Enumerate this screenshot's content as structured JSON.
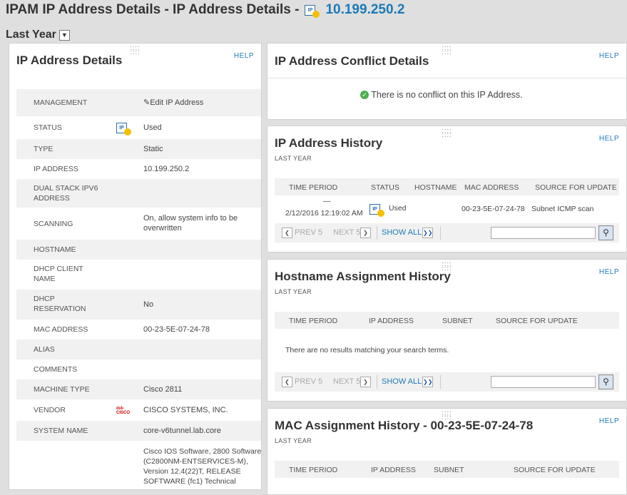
{
  "page": {
    "title": "IPAM IP Address Details - IP Address Details -",
    "ip_link": "10.199.250.2",
    "ip_icon_text": "IP",
    "period": "Last Year"
  },
  "common": {
    "help": "HELP",
    "last_year": "LAST YEAR",
    "prev": "PREV 5",
    "next": "NEXT 5",
    "show_all": "SHOW ALL"
  },
  "details": {
    "title": "IP Address Details",
    "rows": [
      {
        "label": "MANAGEMENT",
        "value": "Edit IP Address"
      },
      {
        "label": "STATUS",
        "value": "Used"
      },
      {
        "label": "TYPE",
        "value": "Static"
      },
      {
        "label": "IP ADDRESS",
        "value": "10.199.250.2"
      },
      {
        "label": "DUAL STACK IPV6\nADDRESS",
        "value": ""
      },
      {
        "label": "SCANNING",
        "value": "On, allow system info to be\noverwritten"
      },
      {
        "label": "HOSTNAME",
        "value": ""
      },
      {
        "label": "DHCP CLIENT\nNAME",
        "value": ""
      },
      {
        "label": "DHCP\nRESERVATION",
        "value": "No"
      },
      {
        "label": "MAC ADDRESS",
        "value": "00-23-5E-07-24-78"
      },
      {
        "label": "ALIAS",
        "value": ""
      },
      {
        "label": "COMMENTS",
        "value": ""
      },
      {
        "label": "MACHINE TYPE",
        "value": "Cisco 2811"
      },
      {
        "label": "VENDOR",
        "value": "CISCO SYSTEMS, INC."
      },
      {
        "label": "SYSTEM NAME",
        "value": "core-v6tunnel.lab.core"
      },
      {
        "label": "",
        "value": "Cisco IOS Software, 2800 Software\n(C2800NM-ENTSERVICES-M),\nVersion 12.4(22)T, RELEASE\nSOFTWARE (fc1) Technical"
      }
    ]
  },
  "conflict": {
    "title": "IP Address Conflict Details",
    "message": "There is no conflict on this IP Address."
  },
  "history": {
    "title": "IP Address History",
    "columns": [
      "TIME PERIOD",
      "STATUS",
      "HOSTNAME",
      "MAC ADDRESS",
      "SOURCE FOR UPDATE"
    ],
    "row": {
      "dash": "—",
      "time": "2/12/2016 12:19:02 AM",
      "status": "Used",
      "mac": "00-23-5E-07-24-78",
      "source": "Subnet ICMP scan"
    }
  },
  "hostname_history": {
    "title": "Hostname Assignment History",
    "columns": [
      "TIME PERIOD",
      "IP ADDRESS",
      "SUBNET",
      "SOURCE FOR UPDATE"
    ],
    "empty": "There are no results matching your search terms."
  },
  "mac_history": {
    "title": "MAC Assignment History - 00-23-5E-07-24-78",
    "columns": [
      "TIME PERIOD",
      "IP ADDRESS",
      "SUBNET",
      "SOURCE FOR UPDATE"
    ]
  },
  "colors": {
    "accent": "#1c7ab8",
    "status_used": "#f5c000",
    "ok": "#4caf50"
  }
}
